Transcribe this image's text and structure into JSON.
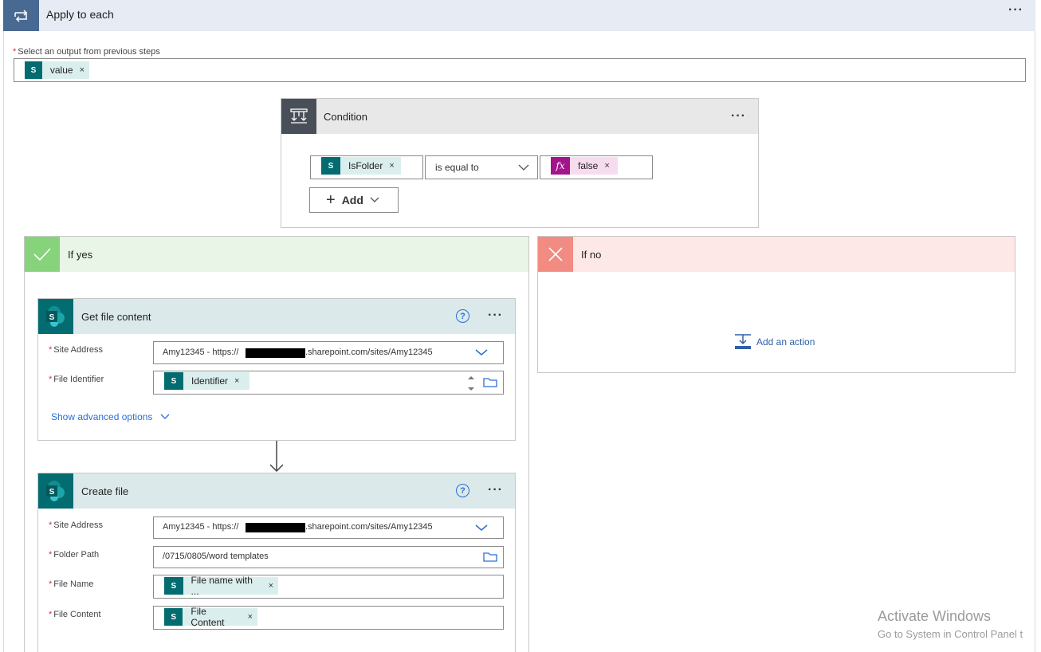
{
  "apply_to_each": {
    "title": "Apply to each",
    "more": "···",
    "select_label": "Select an output from previous steps",
    "token_value": "value"
  },
  "condition": {
    "title": "Condition",
    "more": "···",
    "left_token": "IsFolder",
    "operator": "is equal to",
    "right_token": "false",
    "add_label": "Add",
    "plus": "+"
  },
  "if_yes": {
    "title": "If yes"
  },
  "if_no": {
    "title": "If no",
    "add_action": "Add an action"
  },
  "get_file_content": {
    "title": "Get file content",
    "help": "?",
    "more": "···",
    "site_address_label": "Site Address",
    "site_address_prefix": "Amy12345 - https://",
    "site_address_suffix": ".sharepoint.com/sites/Amy12345",
    "file_identifier_label": "File Identifier",
    "file_identifier_token": "Identifier",
    "show_advanced": "Show advanced options"
  },
  "create_file": {
    "title": "Create file",
    "help": "?",
    "more": "···",
    "site_address_label": "Site Address",
    "site_address_prefix": "Amy12345 - https://",
    "site_address_suffix": ".sharepoint.com/sites/Amy12345",
    "folder_path_label": "Folder Path",
    "folder_path_value": "/0715/0805/word templates",
    "file_name_label": "File Name",
    "file_name_token": "File name with ...",
    "file_content_label": "File Content",
    "file_content_token": "File Content"
  },
  "watermark": {
    "line1": "Activate Windows",
    "line2": "Go to System in Control Panel t"
  },
  "token_remove": "×",
  "required_mark": "*",
  "sp_glyph": "S",
  "fx_glyph": "fx",
  "colors": {
    "sharepoint": "#036c70",
    "apply_icon": "#486991",
    "condition_icon": "#484f58",
    "yes": "#87d37b",
    "no": "#f28b82",
    "link": "#2b6fd6"
  }
}
